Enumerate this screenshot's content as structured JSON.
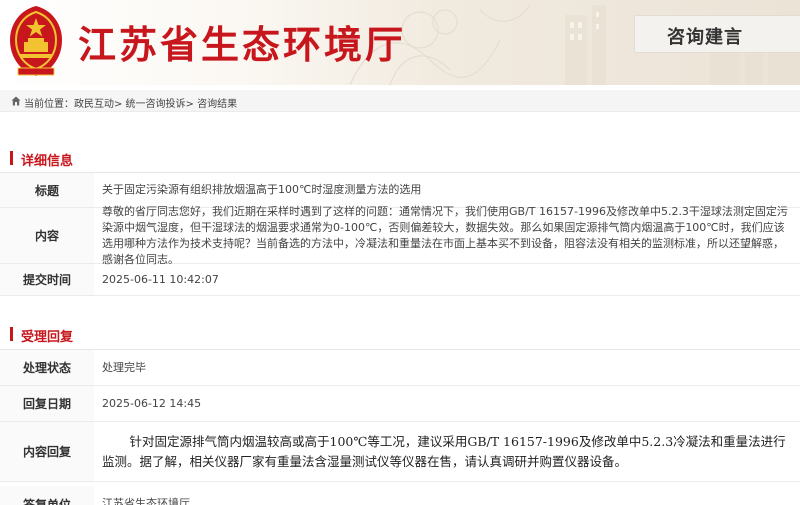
{
  "header": {
    "site_title": "江苏省生态环境厅",
    "consult_tab": "咨询建言"
  },
  "breadcrumb": {
    "text": "当前位置：政民互动> 统一咨询投诉> 咨询结果"
  },
  "detail": {
    "section_title": "详细信息",
    "rows": [
      {
        "label": "标题",
        "value": "关于固定污染源有组织排放烟温高于100℃时湿度测量方法的选用"
      },
      {
        "label": "内容",
        "value": "尊敬的省厅同志您好，我们近期在采样时遇到了这样的问题：通常情况下，我们使用GB/T 16157-1996及修改单中5.2.3干湿球法测定固定污染源中烟气湿度，但干湿球法的烟温要求通常为0-100℃，否则偏差较大，数据失效。那么如果固定源排气筒内烟温高于100℃时，我们应该选用哪种方法作为技术支持呢？当前备选的方法中，冷凝法和重量法在市面上基本买不到设备，阻容法没有相关的监测标准，所以还望解惑，感谢各位同志。"
      },
      {
        "label": "提交时间",
        "value": "2025-06-11 10:42:07"
      }
    ]
  },
  "reply": {
    "section_title": "受理回复",
    "rows": [
      {
        "label": "处理状态",
        "value": "处理完毕"
      },
      {
        "label": "回复日期",
        "value": "2025-06-12 14:45"
      },
      {
        "label": "内容回复",
        "value": "针对固定源排气筒内烟温较高或高于100℃等工况，建议采用GB/T 16157-1996及修改单中5.2.3冷凝法和重量法进行监测。据了解，相关仪器厂家有重量法含湿量测试仪等仪器在售，请认真调研并购置仪器设备。"
      },
      {
        "label": "答复单位",
        "value": "江苏省生态环境厅"
      }
    ]
  },
  "colors": {
    "accent": "#c8161d",
    "label_bg": "#fafafa",
    "crumb_bg": "#f5f5f5"
  },
  "icons": [
    "national-emblem-icon",
    "home-icon"
  ]
}
